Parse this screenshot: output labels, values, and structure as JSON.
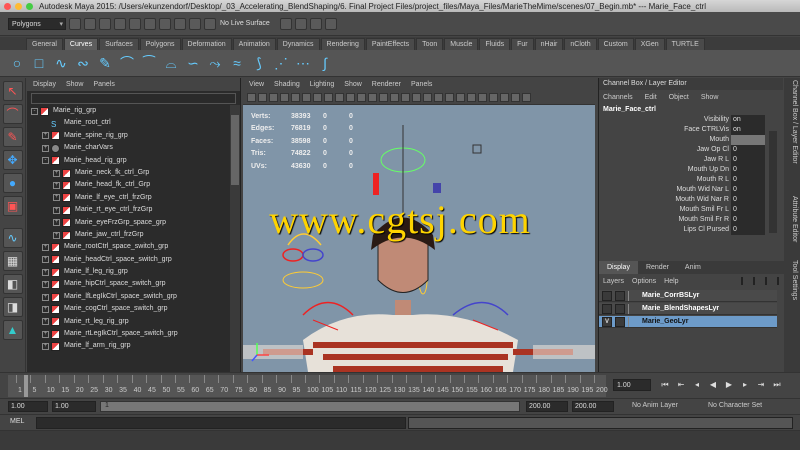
{
  "window": {
    "title": "Autodesk Maya 2015: /Users/ekunzendorf/Desktop/_03_Accelerating_BlendShaping/6. Final Project Files/project_files/Maya_Files/MarieTheMime/scenes/07_Begin.mb* --- Marie_Face_ctrl"
  },
  "statusline": {
    "mode": "Polygons",
    "live_surface": "No Live Surface"
  },
  "shelf": {
    "tabs": [
      "General",
      "Curves",
      "Surfaces",
      "Polygons",
      "Deformation",
      "Animation",
      "Dynamics",
      "Rendering",
      "PaintEffects",
      "Toon",
      "Muscle",
      "Fluids",
      "Fur",
      "nHair",
      "nCloth",
      "Custom",
      "XGen",
      "TURTLE"
    ],
    "active_tab": "Curves"
  },
  "outliner": {
    "menu": [
      "Display",
      "Show",
      "Panels"
    ],
    "items": [
      {
        "label": "Marie_rig_grp",
        "indent": 0,
        "expand": "-",
        "icon": "transform"
      },
      {
        "label": "Marie_root_ctrl",
        "indent": 1,
        "expand": "",
        "icon": "curve"
      },
      {
        "label": "Marie_spine_rig_grp",
        "indent": 1,
        "expand": "+",
        "icon": "transform"
      },
      {
        "label": "Marie_charVars",
        "indent": 1,
        "expand": "+",
        "icon": "locator"
      },
      {
        "label": "Marie_head_rig_grp",
        "indent": 1,
        "expand": "-",
        "icon": "transform"
      },
      {
        "label": "Marie_neck_fk_ctrl_Grp",
        "indent": 2,
        "expand": "+",
        "icon": "transform"
      },
      {
        "label": "Marie_head_fk_ctrl_Grp",
        "indent": 2,
        "expand": "+",
        "icon": "transform"
      },
      {
        "label": "Marie_lf_eye_ctrl_frzGrp",
        "indent": 2,
        "expand": "+",
        "icon": "transform"
      },
      {
        "label": "Marie_rt_eye_ctrl_frzGrp",
        "indent": 2,
        "expand": "+",
        "icon": "transform"
      },
      {
        "label": "Marie_eyeFrzGrp_space_grp",
        "indent": 2,
        "expand": "+",
        "icon": "transform"
      },
      {
        "label": "Marie_jaw_ctrl_frzGrp",
        "indent": 2,
        "expand": "+",
        "icon": "transform"
      },
      {
        "label": "Marie_rootCtrl_space_switch_grp",
        "indent": 1,
        "expand": "+",
        "icon": "transform"
      },
      {
        "label": "Marie_headCtrl_space_switch_grp",
        "indent": 1,
        "expand": "+",
        "icon": "transform"
      },
      {
        "label": "Marie_lf_leg_rig_grp",
        "indent": 1,
        "expand": "+",
        "icon": "transform"
      },
      {
        "label": "Marie_hipCtrl_space_switch_grp",
        "indent": 1,
        "expand": "+",
        "icon": "transform"
      },
      {
        "label": "Marie_lfLegIkCtrl_space_switch_grp",
        "indent": 1,
        "expand": "+",
        "icon": "transform"
      },
      {
        "label": "Marie_cogCtrl_space_switch_grp",
        "indent": 1,
        "expand": "+",
        "icon": "transform"
      },
      {
        "label": "Marie_rt_leg_rig_grp",
        "indent": 1,
        "expand": "+",
        "icon": "transform"
      },
      {
        "label": "Marie_rtLegIkCtrl_space_switch_grp",
        "indent": 1,
        "expand": "+",
        "icon": "transform"
      },
      {
        "label": "Marie_lf_arm_rig_grp",
        "indent": 1,
        "expand": "+",
        "icon": "transform"
      }
    ]
  },
  "viewport": {
    "menu": [
      "View",
      "Shading",
      "Lighting",
      "Show",
      "Renderer",
      "Panels"
    ],
    "hud": [
      {
        "label": "Verts:",
        "a": "38393",
        "b": "0",
        "c": "0"
      },
      {
        "label": "Edges:",
        "a": "76819",
        "b": "0",
        "c": "0"
      },
      {
        "label": "Faces:",
        "a": "38598",
        "b": "0",
        "c": "0"
      },
      {
        "label": "Tris:",
        "a": "74822",
        "b": "0",
        "c": "0"
      },
      {
        "label": "UVs:",
        "a": "43630",
        "b": "0",
        "c": "0"
      }
    ]
  },
  "watermark": "www.cgtsj.com",
  "channelbox": {
    "header": "Channel Box / Layer Editor",
    "menu": [
      "Channels",
      "Edit",
      "Object",
      "Show"
    ],
    "object": "Marie_Face_ctrl",
    "channels": [
      {
        "label": "Visibility",
        "value": "on"
      },
      {
        "label": "Face CTRLVis",
        "value": "on"
      },
      {
        "label": "Mouth",
        "value": ""
      },
      {
        "label": "Jaw Op Cl",
        "value": "0"
      },
      {
        "label": "Jaw R L",
        "value": "0"
      },
      {
        "label": "Mouth Up Dn",
        "value": "0"
      },
      {
        "label": "Mouth R L",
        "value": "0"
      },
      {
        "label": "Mouth Wid Nar L",
        "value": "0"
      },
      {
        "label": "Mouth Wid Nar R",
        "value": "0"
      },
      {
        "label": "Mouth Smil Fr L",
        "value": "0"
      },
      {
        "label": "Mouth Smil Fr R",
        "value": "0"
      },
      {
        "label": "Lips Cl Pursed",
        "value": "0"
      }
    ],
    "layer_tabs": [
      "Display",
      "Render",
      "Anim"
    ],
    "layer_menu": [
      "Layers",
      "Options",
      "Help"
    ],
    "layers": [
      {
        "name": "Marie_CorrBSLyr",
        "v": "",
        "sel": false
      },
      {
        "name": "Marie_BlendShapesLyr",
        "v": "",
        "sel": false
      },
      {
        "name": "Marie_GeoLyr",
        "v": "V",
        "sel": true
      }
    ]
  },
  "side_tabs": [
    "Channel Box / Layer Editor",
    "Attribute Editor",
    "Tool Settings"
  ],
  "timeslider": {
    "ticks": [
      "1",
      "5",
      "10",
      "15",
      "20",
      "25",
      "30",
      "35",
      "40",
      "45",
      "50",
      "55",
      "60",
      "65",
      "70",
      "75",
      "80",
      "85",
      "90",
      "95",
      "100",
      "105",
      "110",
      "115",
      "120",
      "125",
      "130",
      "135",
      "140",
      "145",
      "150",
      "155",
      "160",
      "165",
      "170",
      "175",
      "180",
      "185",
      "190",
      "195",
      "200"
    ],
    "current_frame": "1.00"
  },
  "rangeslider": {
    "start": "1.00",
    "start_inner": "1.00",
    "range_marker": "1",
    "end_inner": "200.00",
    "end": "200.00",
    "anim_layer": "No Anim Layer",
    "character": "No Character Set"
  },
  "cmdline": {
    "label": "MEL"
  }
}
